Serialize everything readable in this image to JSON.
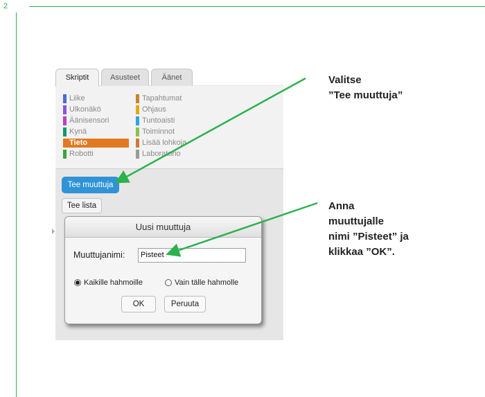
{
  "page_number": "2",
  "tabs": [
    {
      "label": "Skriptit",
      "active": true
    },
    {
      "label": "Asusteet",
      "active": false
    },
    {
      "label": "Äänet",
      "active": false
    }
  ],
  "categories_left": [
    {
      "label": "Liike",
      "color": "#4a6cd4"
    },
    {
      "label": "Ulkonäkö",
      "color": "#8a55d7"
    },
    {
      "label": "Äänisensori",
      "color": "#bb42c3"
    },
    {
      "label": "Kynä",
      "color": "#0e9a6c"
    },
    {
      "label": "Tieto",
      "color": "#e07b24",
      "selected": true
    },
    {
      "label": "Robotti",
      "color": "#3ea53e"
    }
  ],
  "categories_right": [
    {
      "label": "Tapahtumat",
      "color": "#c88330"
    },
    {
      "label": "Ohjaus",
      "color": "#e1a91a"
    },
    {
      "label": "Tuntoaisti",
      "color": "#2ca5e2"
    },
    {
      "label": "Toiminnot",
      "color": "#8bc34a"
    },
    {
      "label": "Lisää lohkoja",
      "color": "#d0783a"
    },
    {
      "label": "Laboratorio",
      "color": "#9b9b9b"
    }
  ],
  "buttons": {
    "make_variable": "Tee muuttuja",
    "make_list": "Tee lista"
  },
  "dialog": {
    "title": "Uusi muuttuja",
    "name_label": "Muuttujanimi:",
    "name_value": "Pisteet",
    "radio_all": "Kaikille hahmoille",
    "radio_this": "Vain tälle hahmolle",
    "radio_all_selected": true,
    "ok": "OK",
    "cancel": "Peruuta"
  },
  "notes": {
    "note1_line1": "Valitse",
    "note1_line2": "”Tee muuttuja”",
    "note2_line1": "Anna",
    "note2_line2": "muuttujalle",
    "note2_line3": "nimi ”Pisteet” ja",
    "note2_line4": "klikkaa ”OK”."
  },
  "colors": {
    "accent_green": "#2bb24c",
    "button_blue": "#2f93d6",
    "selected_orange": "#e07b24"
  }
}
